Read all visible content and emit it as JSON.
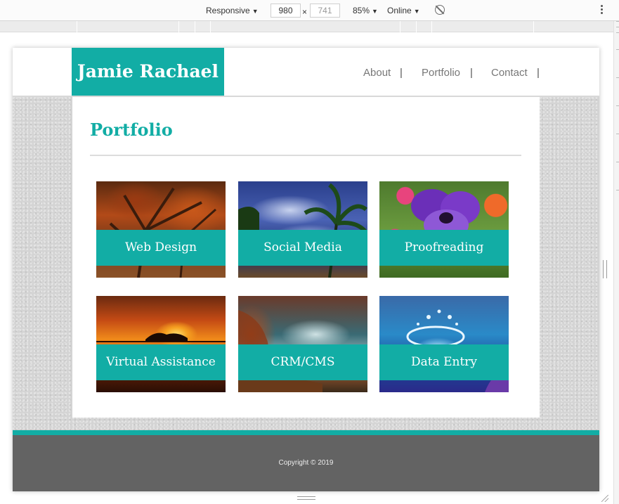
{
  "devtools": {
    "device": "Responsive",
    "width": "980",
    "height": "741",
    "times": "×",
    "zoom": "85%",
    "network": "Online",
    "caret": "▼"
  },
  "site": {
    "logo": "Jamie Rachael",
    "nav": [
      {
        "label": "About",
        "sep": "|"
      },
      {
        "label": "Portfolio",
        "sep": "|"
      },
      {
        "label": "Contact",
        "sep": "|"
      }
    ],
    "page_title": "Portfolio",
    "tiles": [
      {
        "label": "Web Design",
        "image": "autumn-tree-photo"
      },
      {
        "label": "Social Media",
        "image": "palm-sky-photo"
      },
      {
        "label": "Proofreading",
        "image": "pansy-flower-photo"
      },
      {
        "label": "Virtual Assistance",
        "image": "sunset-lake-photo"
      },
      {
        "label": "CRM/CMS",
        "image": "coastal-waves-photo"
      },
      {
        "label": "Data Entry",
        "image": "water-splash-photo"
      }
    ],
    "copyright": "Copyright © 2019"
  },
  "colors": {
    "accent": "#12ada5",
    "footer": "#636363"
  }
}
